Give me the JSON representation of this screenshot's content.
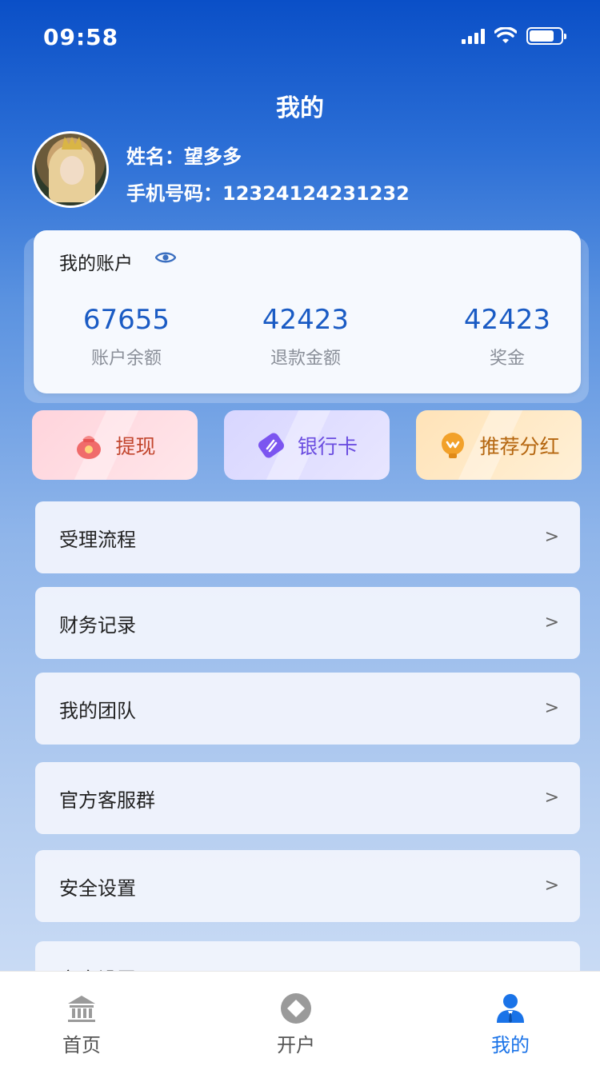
{
  "status_bar": {
    "time": "09:58"
  },
  "header": {
    "title": "我的"
  },
  "profile": {
    "name": "姓名：望多多",
    "phone": "手机号码：12324124231232"
  },
  "account": {
    "title": "我的账户",
    "stats": [
      {
        "value": "67655",
        "label": "账户余额"
      },
      {
        "value": "42423",
        "label": "退款金额"
      },
      {
        "value": "42423",
        "label": "奖金"
      }
    ]
  },
  "actions": {
    "withdraw": "提现",
    "bank_card": "银行卡",
    "referral": "推荐分红"
  },
  "menu": {
    "items": [
      {
        "label": "受理流程",
        "chevron": ">"
      },
      {
        "label": "财务记录",
        "chevron": ">"
      },
      {
        "label": "我的团队",
        "chevron": ">"
      },
      {
        "label": "官方客服群",
        "chevron": ">"
      },
      {
        "label": "安全设置",
        "chevron": ">"
      },
      {
        "label": "安全设置",
        "chevron": ">"
      }
    ]
  },
  "tab_bar": {
    "home": "首页",
    "open_account": "开户",
    "mine": "我的"
  },
  "colors": {
    "accent": "#1a73e8",
    "stat_value": "#1a5bc4",
    "header_top": "#0a4fc7"
  }
}
